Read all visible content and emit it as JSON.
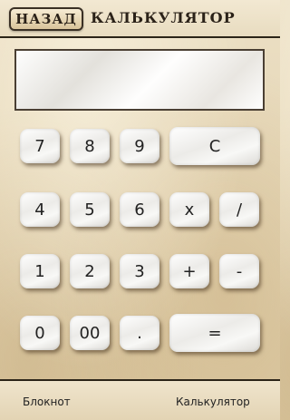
{
  "header": {
    "back_label": "НАЗАД",
    "title": "КАЛЬКУЛЯТОР"
  },
  "display": {
    "value": ""
  },
  "keypad": {
    "k7": "7",
    "k8": "8",
    "k9": "9",
    "clear": "C",
    "k4": "4",
    "k5": "5",
    "k6": "6",
    "multiply": "x",
    "divide": "/",
    "k1": "1",
    "k2": "2",
    "k3": "3",
    "plus": "+",
    "minus": "-",
    "k0": "0",
    "k00": "00",
    "dot": ".",
    "equals": "="
  },
  "footer": {
    "notepad_label": "Блокнот",
    "calculator_label": "Калькулятор"
  },
  "colors": {
    "paper_background": "#e9dcc0",
    "border_dark": "#2b2418",
    "key_face": "#f2f1ee",
    "text": "#222222"
  }
}
